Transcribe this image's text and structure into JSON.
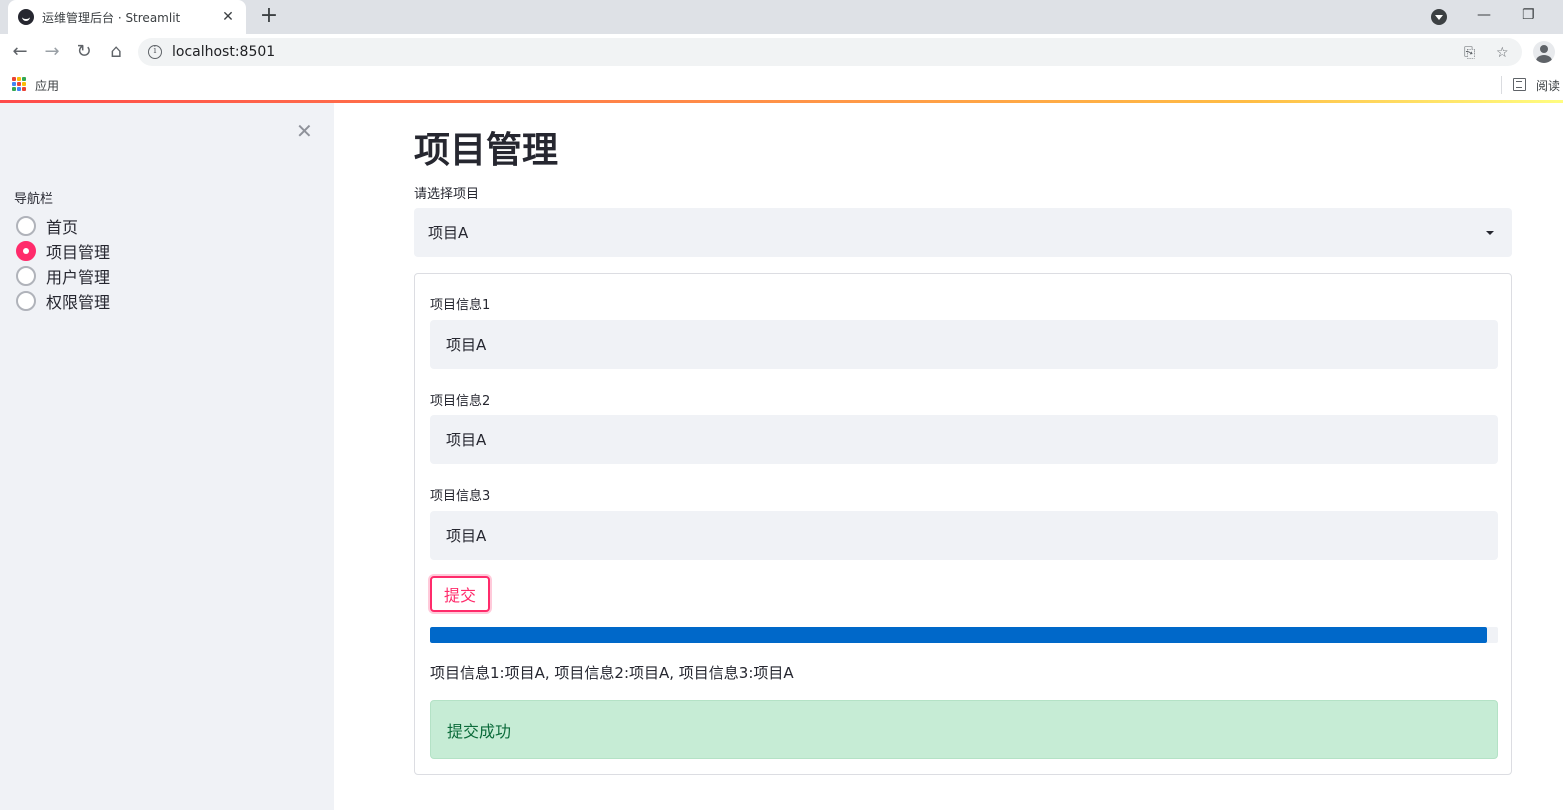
{
  "browser": {
    "tab_title": "运维管理后台 · Streamlit",
    "tab_close": "✕",
    "new_tab": "+",
    "url": "localhost:8501",
    "bookmarks_apps": "应用",
    "reader_label": "阅读"
  },
  "sidebar": {
    "close": "✕",
    "nav_label": "导航栏",
    "items": [
      {
        "label": "首页",
        "selected": false
      },
      {
        "label": "项目管理",
        "selected": true
      },
      {
        "label": "用户管理",
        "selected": false
      },
      {
        "label": "权限管理",
        "selected": false
      }
    ]
  },
  "main": {
    "title": "项目管理",
    "select_label": "请选择项目",
    "select_value": "项目A",
    "form": {
      "fields": [
        {
          "label": "项目信息1",
          "value": "项目A"
        },
        {
          "label": "项目信息2",
          "value": "项目A"
        },
        {
          "label": "项目信息3",
          "value": "项目A"
        }
      ],
      "submit_label": "提交",
      "progress": 0.99,
      "result_text": "项目信息1:项目A, 项目信息2:项目A, 项目信息3:项目A",
      "success_text": "提交成功"
    }
  },
  "colors": {
    "primary": "#ff2b6b",
    "progress": "#0068c9",
    "success_bg": "#c6ecd5",
    "success_text": "#0b6b3a"
  }
}
